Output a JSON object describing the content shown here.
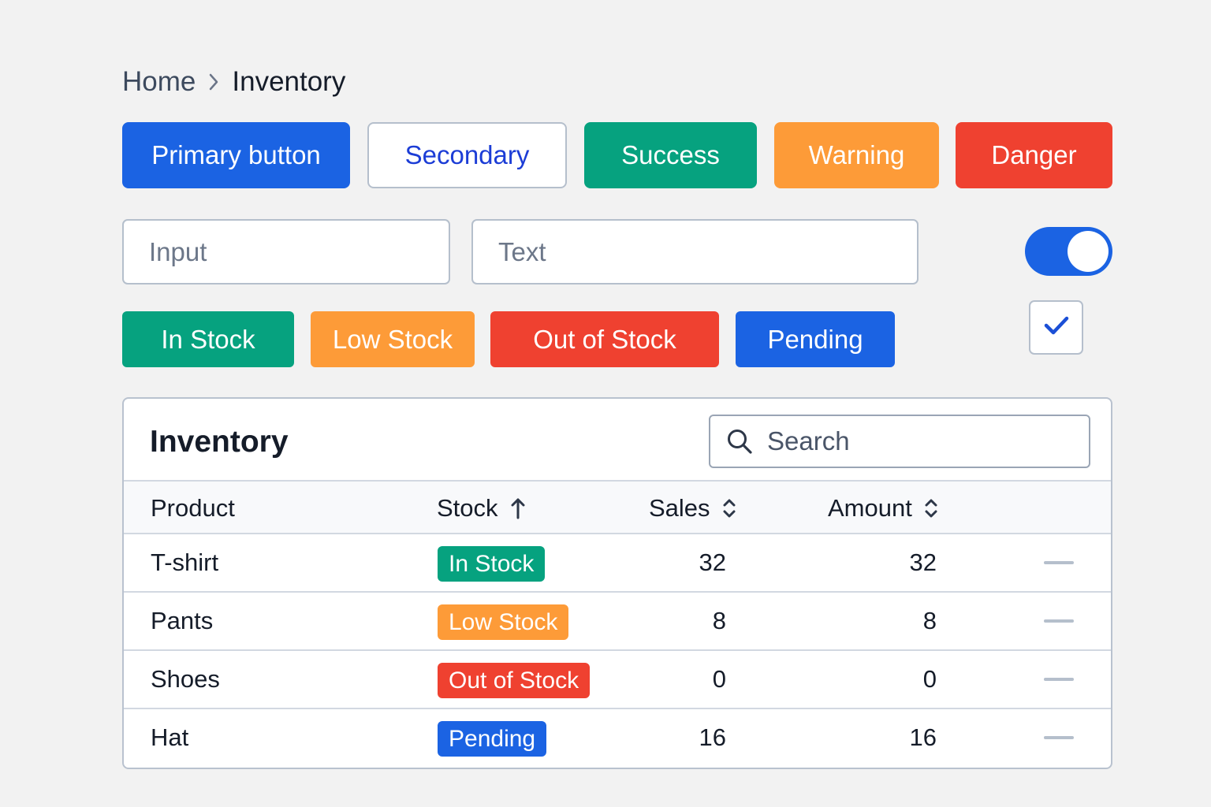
{
  "breadcrumb": {
    "home": "Home",
    "current": "Inventory"
  },
  "buttons": {
    "primary": "Primary button",
    "secondary": "Secondary",
    "success": "Success",
    "warning": "Warning",
    "danger": "Danger"
  },
  "inputs": {
    "input_placeholder": "Input",
    "text_placeholder": "Text"
  },
  "toggle": {
    "on": true
  },
  "checkbox": {
    "checked": true
  },
  "status_chips": {
    "in_stock": "In Stock",
    "low_stock": "Low Stock",
    "out_of_stock": "Out of Stock",
    "pending": "Pending"
  },
  "table": {
    "title": "Inventory",
    "search_placeholder": "Search",
    "columns": {
      "product": "Product",
      "stock": "Stock",
      "sales": "Sales",
      "amount": "Amount"
    },
    "rows": [
      {
        "product": "T-shirt",
        "stock": "In Stock",
        "sales": "32",
        "amount": "32"
      },
      {
        "product": "Pants",
        "stock": "Low Stock",
        "sales": "8",
        "amount": "8"
      },
      {
        "product": "Shoes",
        "stock": "Out of Stock",
        "sales": "0",
        "amount": "0"
      },
      {
        "product": "Hat",
        "stock": "Pending",
        "sales": "16",
        "amount": "16"
      }
    ]
  },
  "colors": {
    "primary": "#1b63e3",
    "success": "#06a27f",
    "warning": "#fd9b38",
    "danger": "#ef4130",
    "secondary_text": "#1c3dd6"
  },
  "icons": {
    "breadcrumb_separator": "chevron-right-icon",
    "search": "search-icon",
    "checkbox": "check-icon",
    "stock_sort": "arrow-up-icon",
    "sales_sort": "sort-icon",
    "amount_sort": "sort-icon",
    "row_action": "minus-icon"
  }
}
